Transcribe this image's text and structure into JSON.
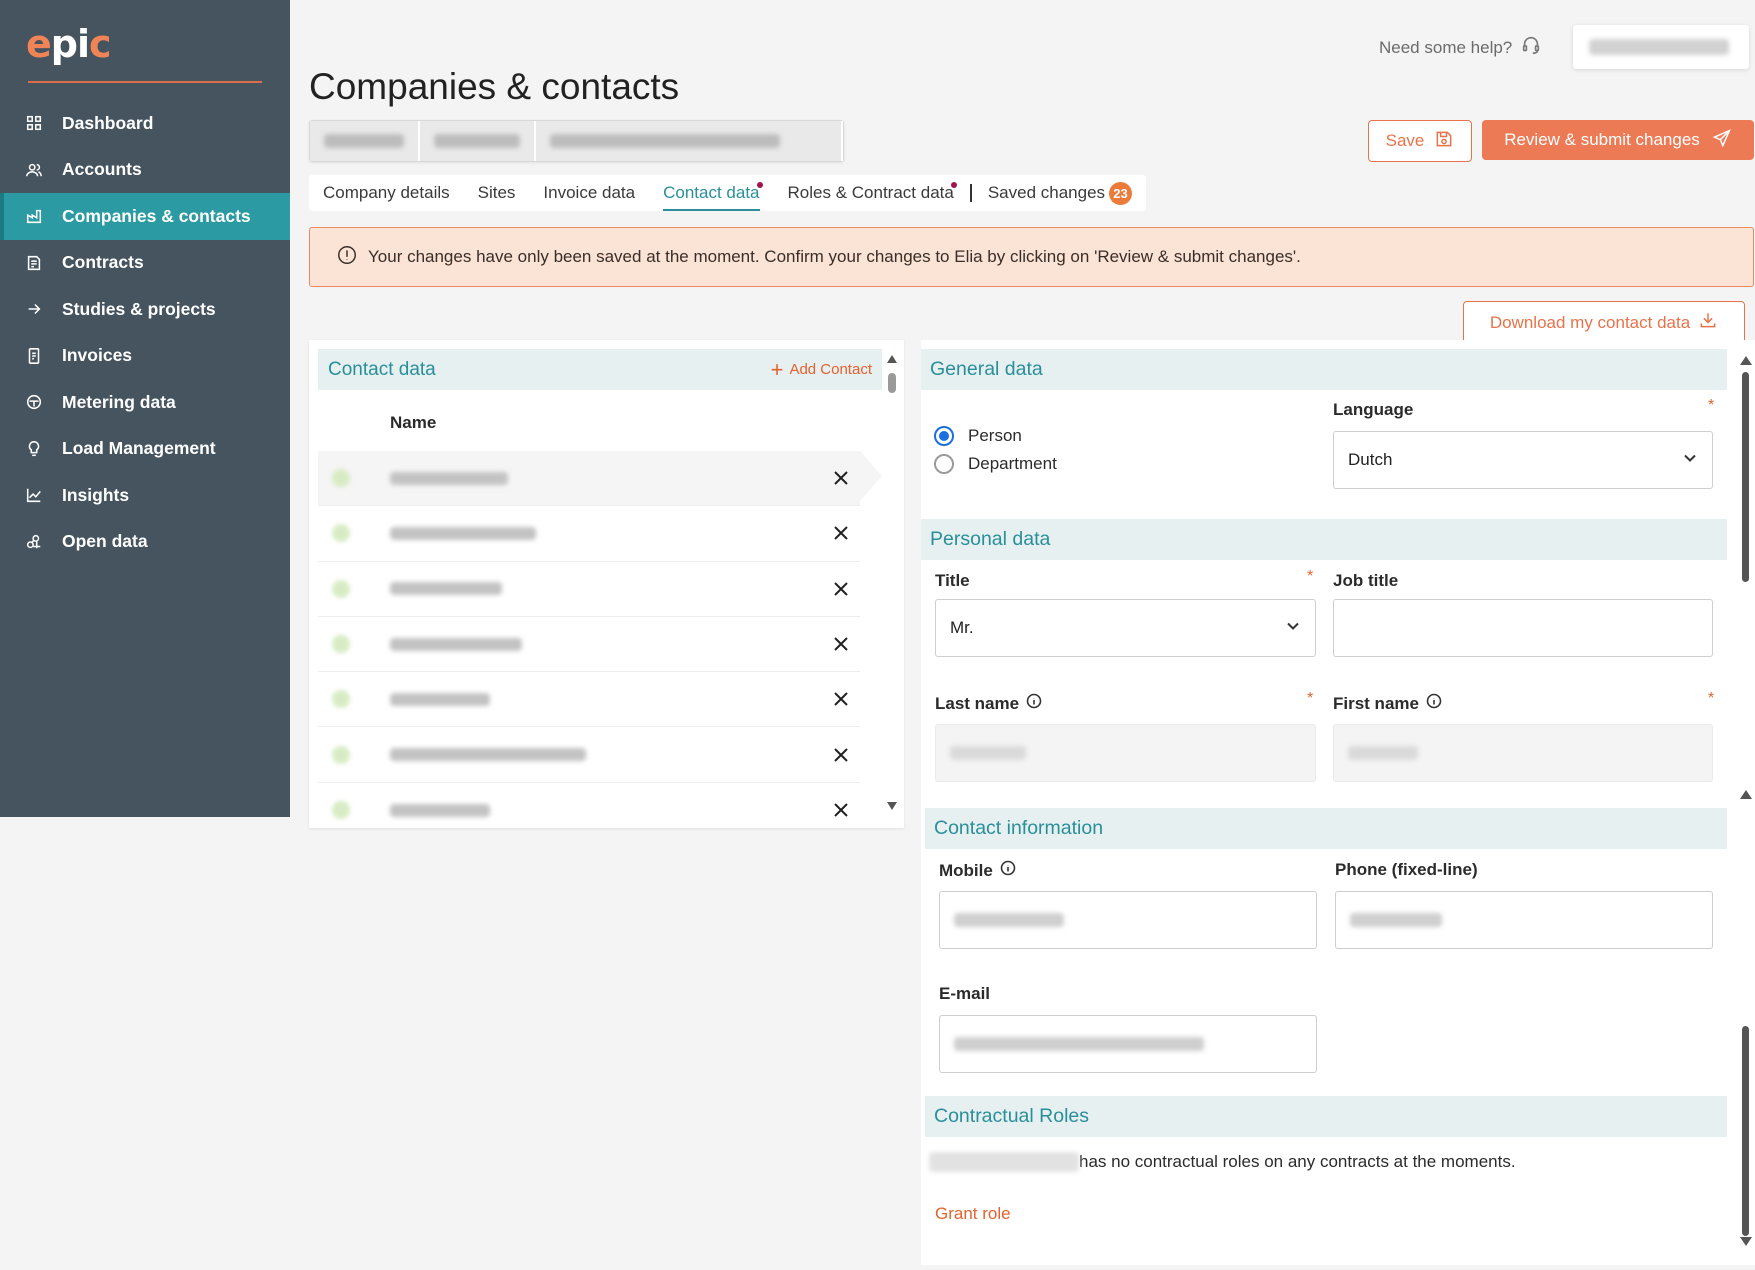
{
  "app": {
    "logo_text": "epic",
    "page_title": "Companies & contacts",
    "help_text": "Need some help?"
  },
  "sidebar": {
    "items": [
      {
        "label": "Dashboard",
        "icon": "dashboard-icon",
        "active": false
      },
      {
        "label": "Accounts",
        "icon": "accounts-icon",
        "active": false
      },
      {
        "label": "Companies & contacts",
        "icon": "companies-icon",
        "active": true
      },
      {
        "label": "Contracts",
        "icon": "contracts-icon",
        "active": false
      },
      {
        "label": "Studies & projects",
        "icon": "arrow-right-icon",
        "active": false
      },
      {
        "label": "Invoices",
        "icon": "invoice-icon",
        "active": false
      },
      {
        "label": "Metering data",
        "icon": "meter-icon",
        "active": false
      },
      {
        "label": "Load Management",
        "icon": "lightbulb-icon",
        "active": false
      },
      {
        "label": "Insights",
        "icon": "chart-icon",
        "active": false
      },
      {
        "label": "Open data",
        "icon": "open-data-icon",
        "active": false
      }
    ]
  },
  "toolbar": {
    "save_label": "Save",
    "review_label": "Review & submit changes",
    "download_label": "Download my contact data"
  },
  "tabs": [
    {
      "label": "Company details",
      "active": false,
      "dot": false
    },
    {
      "label": "Sites",
      "active": false,
      "dot": false
    },
    {
      "label": "Invoice data",
      "active": false,
      "dot": false
    },
    {
      "label": "Contact data",
      "active": true,
      "dot": true
    },
    {
      "label": "Roles & Contract data",
      "active": false,
      "dot": true
    },
    {
      "label": "Saved changes",
      "active": false,
      "dot": false,
      "badge": "23"
    }
  ],
  "alert": {
    "text": "Your changes have only been saved at the moment. Confirm your changes to Elia by clicking on 'Review & submit changes'."
  },
  "contact_list": {
    "title": "Contact data",
    "add_label": "Add Contact",
    "column_name": "Name"
  },
  "general": {
    "title": "General data",
    "type_person": "Person",
    "type_department": "Department",
    "selected_type": "Person",
    "language_label": "Language",
    "language_value": "Dutch"
  },
  "personal": {
    "title": "Personal data",
    "title_label": "Title",
    "title_value": "Mr.",
    "job_title_label": "Job title",
    "job_title_value": "",
    "last_name_label": "Last name",
    "first_name_label": "First name"
  },
  "contact_info": {
    "title": "Contact information",
    "mobile_label": "Mobile",
    "phone_label": "Phone (fixed-line)",
    "email_label": "E-mail"
  },
  "roles": {
    "title": "Contractual Roles",
    "text": "has no contractual roles on any contracts at the moments.",
    "grant_label": "Grant role"
  },
  "colors": {
    "sidebar_bg": "#45545f",
    "active_teal": "#2b9aa3",
    "accent_orange": "#ec7a55",
    "alert_bg": "#fbe3d6"
  }
}
